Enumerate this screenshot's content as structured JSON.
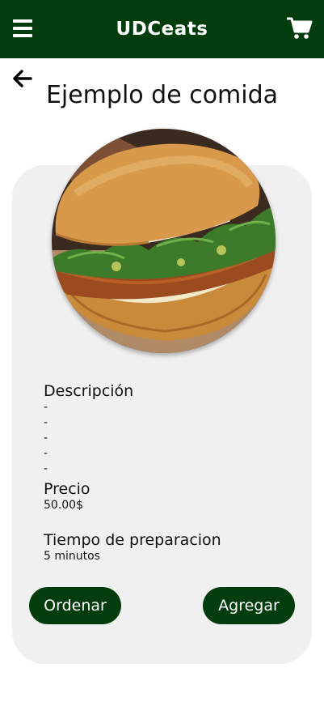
{
  "app": {
    "title": "UDCeats"
  },
  "page": {
    "title": "Ejemplo de comida"
  },
  "details": {
    "description_label": "Descripción",
    "description_lines": [
      "-",
      "-",
      "-",
      "-",
      "-"
    ],
    "price_label": "Precio",
    "price_value": "50.00$",
    "prep_label": "Tiempo de preparacion",
    "prep_value": "5 minutos"
  },
  "actions": {
    "order_label": "Ordenar",
    "add_label": "Agregar"
  },
  "icons": {
    "menu": "menu-icon",
    "cart": "cart-icon",
    "back": "arrow-left-icon"
  },
  "colors": {
    "primary": "#043d0d",
    "card_background": "#f0f0f0"
  }
}
